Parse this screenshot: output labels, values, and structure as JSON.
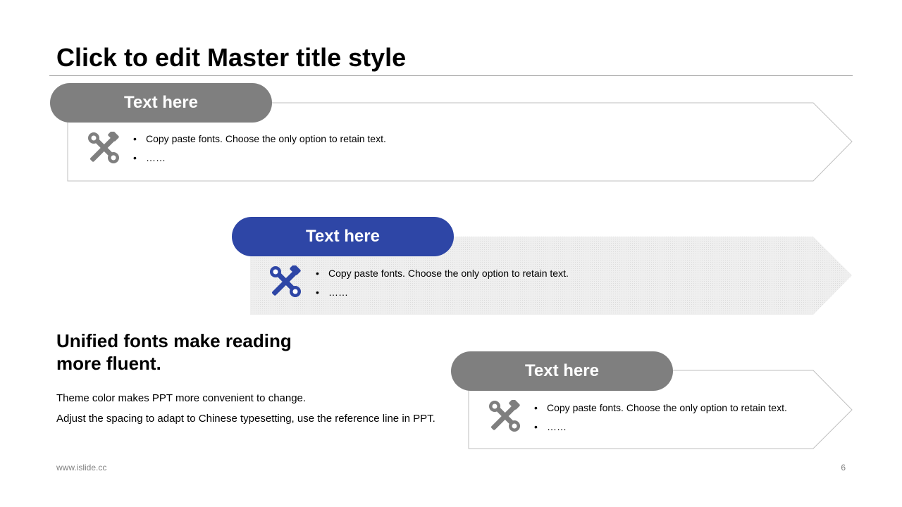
{
  "slide": {
    "title": "Click to edit Master title style",
    "footer_url": "www.islide.cc",
    "page_number": "6"
  },
  "colors": {
    "gray_pill": "#7f7f7f",
    "blue_pill": "#2e46a6",
    "outline": "#bfbfbf",
    "icon_gray": "#7f7f7f",
    "icon_blue": "#2e46a6",
    "shaded_fill": "#ededed"
  },
  "steps": [
    {
      "label": "Text here",
      "icon": "tools-icon",
      "bullets": [
        "Copy paste fonts. Choose the only option to retain text.",
        "……"
      ]
    },
    {
      "label": "Text here",
      "icon": "tools-icon",
      "bullets": [
        "Copy paste fonts. Choose the only option to retain text.",
        "……"
      ]
    },
    {
      "label": "Text here",
      "icon": "tools-icon",
      "bullets": [
        "Copy paste fonts. Choose the only option to retain text.",
        "……"
      ]
    }
  ],
  "side_text": {
    "heading": "Unified fonts make reading more fluent.",
    "body_lines": [
      "Theme color makes PPT more convenient to change.",
      "Adjust the spacing to adapt to Chinese typesetting, use the reference line in PPT."
    ]
  }
}
